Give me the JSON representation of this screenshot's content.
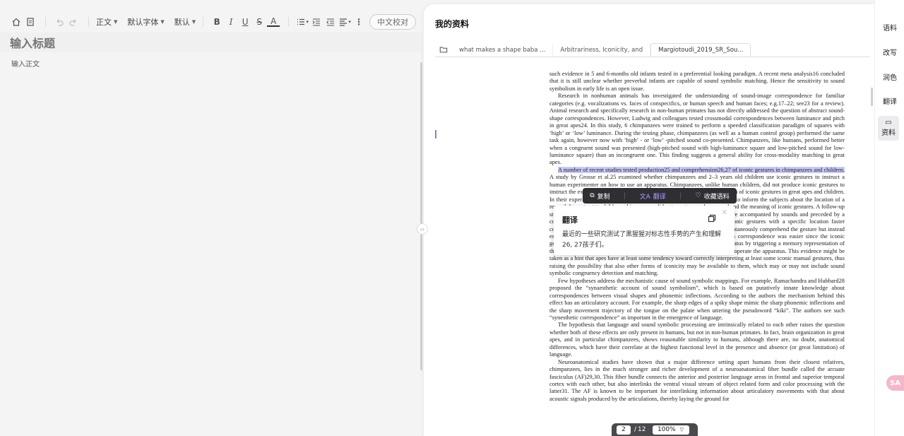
{
  "toolbar": {
    "paragraph_style": "正文",
    "font_family": "默认字体",
    "font_size": "默认",
    "proofread_label": "中文校对"
  },
  "editor": {
    "title_placeholder": "输入标题",
    "body_placeholder": "输入正文"
  },
  "panel": {
    "title": "我的资料",
    "tabs": [
      {
        "label": "what makes a shape baba ..."
      },
      {
        "label": "Arbitrariness, Iconicity, and"
      },
      {
        "label": "Margiotoudi_2019_SR_Sou..."
      }
    ]
  },
  "selection_toolbar": {
    "copy": "复制",
    "translate": "翻译",
    "collect": "收藏语料"
  },
  "translation": {
    "title": "翻译",
    "content": "最近的一些研究测试了黑猩猩对标志性手势的产生和理解26, 27孩子们。",
    "close": "×"
  },
  "pager": {
    "current_page": "2",
    "separator": "/",
    "total_pages": "12",
    "zoom": "100%"
  },
  "sidebar": {
    "items": [
      {
        "label": "语料"
      },
      {
        "label": "改写"
      },
      {
        "label": "润色"
      },
      {
        "label": "翻译"
      },
      {
        "label": "资料"
      }
    ]
  },
  "avatar": {
    "label": "SA"
  },
  "colors": {
    "accent": "#6c5ce7",
    "selection_highlight": "#c9c9f6",
    "dark_bar": "#2e2e33",
    "citation_blue": "#3a48d6"
  },
  "document": {
    "paragraphs": [
      {
        "t": "such evidence in 5 and 6-months old infants tested in a preferential looking paradigm. A recent meta analysis16 concluded that it is still unclear whether preverbal infants are capable of sound symbolic matching. Hence the sensitivity to sound symbolism in early life is an open issue."
      },
      {
        "t": "Research in nonhuman animals has investigated the understanding of sound-image correspondence for familiar categories (e.g. vocalizations vs. faces of conspecifics, or human speech and human faces; e.g.17–22; see23 for a review). Animal research and specifically research in non-human primates has not directly addressed the question of abstract sound-shape correspondences. However, Ludwig and colleagues tested crossmodal correspondences between luminance and pitch in great apes24. In this study, 6 chimpanzees were trained to perform a speeded classification paradigm of squares with ‘high’ or ‘low’ luminance. During the testing phase, chimpanzees (as well as a human control group) performed the same task again, however now with ‘high’ - or ‘low’ -pitched sound co-presented. Chimpanzees, like humans, performed better when a congruent sound was presented (high-pitched sound with high-luminance square and low-pitched sound for low-luminance square) than an incongruent one. This finding suggests a general ability for cross-modality matching in great apes."
      },
      {
        "hl": "A number of recent studies tested production25 and comprehension26,27 of iconic gestures in chimpanzees and children.",
        "t": " A study by Grosse et al.25 examined whether chimpanzees and 2–3 years old children use iconic gestures to instruct a human experimenter on how to use an apparatus. Chimpanzees, unlike human children, did not produce iconic gestures to instruct the experimenter. In a similar vein, Bohn et al.26 tested comprehension of iconic gestures in great apes and children. In their experiment, the experimenter used either iconic or arbitrary gestures to inform the subjects about the location of a reward. In contrast to children, chimpanzees did not spontaneously comprehend the meaning of iconic gestures. A follow-up study also found no spontaneous comprehension of iconic gestures that were accompanied by sounds and preceded by a communicative training. However, great apes learned to associate the iconic gestures with a specific location faster compared to the arbitrary gestures. The authors suggest that apes do not spontaneously comprehend the gesture but instead establish the correct association through the mapping of gesture - location correspondence was easier since the iconic gesture may have drawn the great apes’ attention to the corresponding apparatus by triggering a memory representation of the bodily movement, from which the gesture was derived, that was used to operate the apparatus. This evidence might be taken as a hint that apes have at least some tendency toward correctly interpreting at least some iconic manual gestures, thus raising the possibility that also other forms of iconicity may be available to them, which may or may not include sound symbolic congruency detection and matching."
      },
      {
        "t": "Few hypotheses address the mechanistic cause of sound symbolic mappings. For example, Ramachandra and Hubbard28 proposed the “synaesthetic account of sound symbolism”, which is based on putatively innate knowledge about correspondences between visual shapes and phonemic inflections. According to the authors the mechanism behind this effect has an articulatory account. For example, the sharp edges of a spiky shape mimic the sharp phonemic inflections and the sharp movement trajectory of the tongue on the palate when uttering the pseudoword “kiki”. The authors see such “synesthetic correspondence” as important in the emergence of language."
      },
      {
        "t": "The hypothesis that language and sound symbolic processing are intrinsically related to each other raises the question whether both of these effects are only present in humans, but not in non-human primates. In fact, brain organization in great apes, and in particular chimpanzees, shows reasonable similarity to humans, although there are, no doubt, anatomical differences, which have their correlate at the highest functional level in the presence and absence (or great limitation) of language."
      },
      {
        "t": "Neuroanatomical studies have shown that a major difference setting apart humans from their closest relatives, chimpanzees, lies in the much stronger and richer development of a neuroanatomical fiber bundle called the arcuate fasciculus (AF)29,30. This fiber bundle connects the anterior and posterior language areas in frontal and superior temporal cortex with each other, but also interlinks the ventral visual stream of object related form and color processing with the latter31. The AF is known to be important for interlinking information about articulatory movements with that about acoustic signals produced by the articulations, thereby laying the ground for"
      }
    ]
  }
}
